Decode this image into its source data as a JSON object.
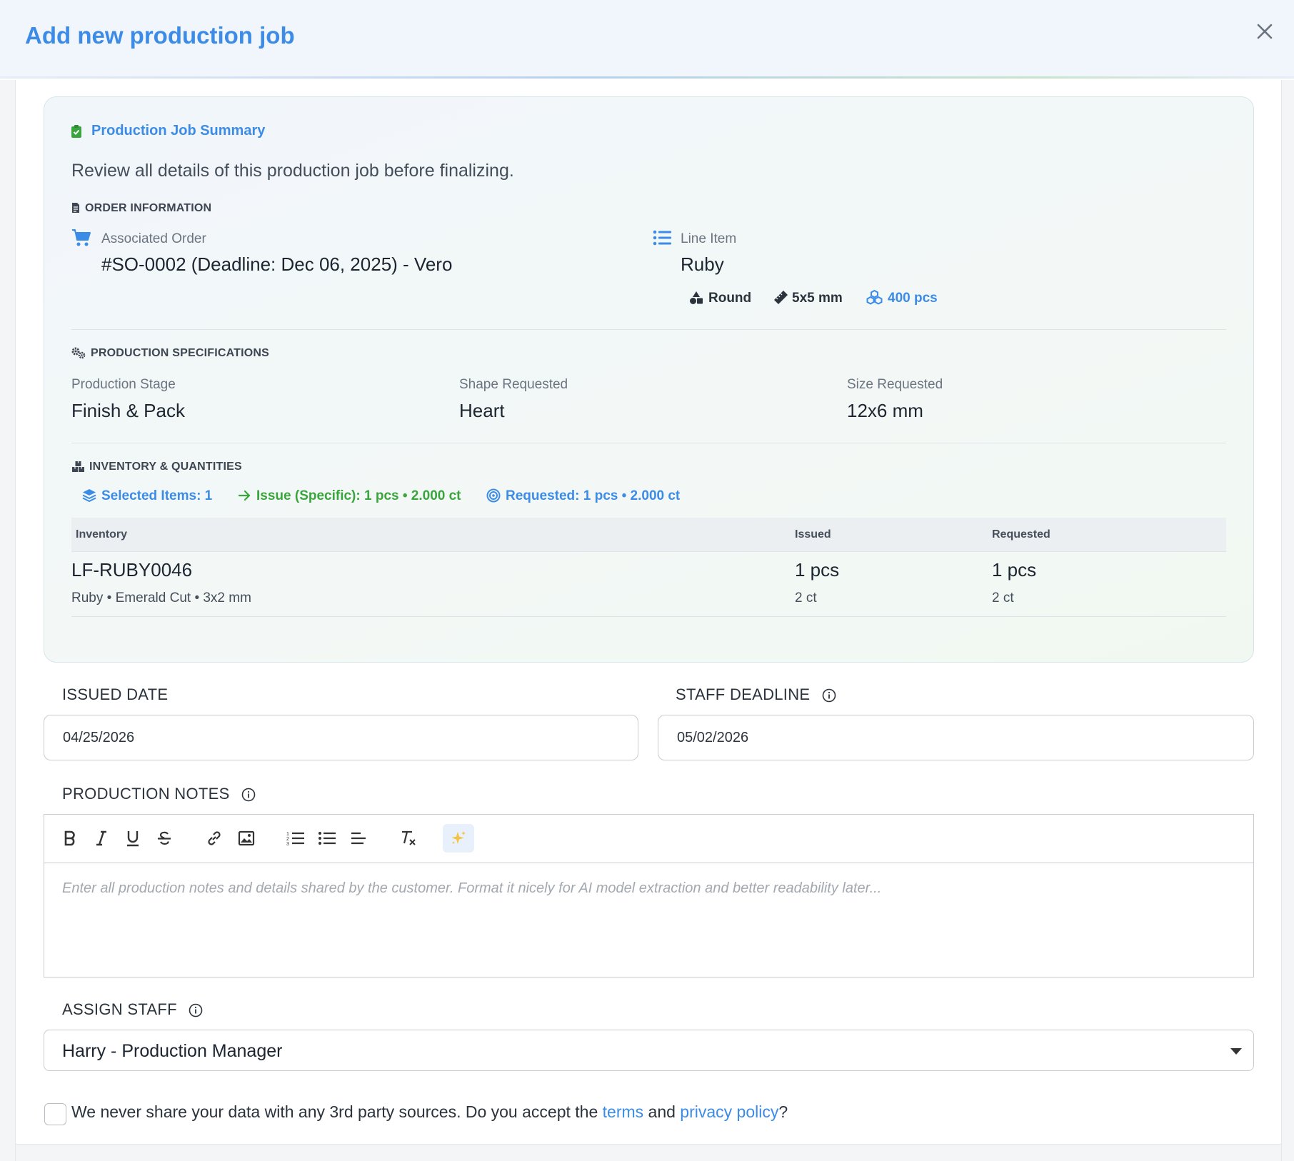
{
  "modal": {
    "title": "Add new production job"
  },
  "summary": {
    "title": "Production Job Summary",
    "description": "Review all details of this production job before finalizing.",
    "order_info": {
      "heading": "ORDER INFORMATION",
      "associated_order_label": "Associated Order",
      "associated_order_value": "#SO-0002 (Deadline: Dec 06, 2025) - Vero",
      "line_item_label": "Line Item",
      "line_item_value": "Ruby",
      "shape": "Round",
      "size": "5x5 mm",
      "quantity": "400 pcs"
    },
    "specs": {
      "heading": "PRODUCTION SPECIFICATIONS",
      "stage_label": "Production Stage",
      "stage_value": "Finish & Pack",
      "shape_label": "Shape Requested",
      "shape_value": "Heart",
      "size_label": "Size Requested",
      "size_value": "12x6 mm"
    },
    "inventory": {
      "heading": "INVENTORY & QUANTITIES",
      "selected_items": "Selected Items: 1",
      "issue_specific": "Issue (Specific): 1 pcs • 2.000 ct",
      "requested": "Requested: 1 pcs • 2.000 ct",
      "columns": [
        "Inventory",
        "Issued",
        "Requested"
      ],
      "rows": [
        {
          "code": "LF-RUBY0046",
          "details": "Ruby • Emerald Cut • 3x2 mm",
          "issued_pcs": "1 pcs",
          "issued_ct": "2 ct",
          "requested_pcs": "1 pcs",
          "requested_ct": "2 ct"
        }
      ]
    }
  },
  "form": {
    "issued_date_label": "ISSUED DATE",
    "issued_date_value": "04/25/2026",
    "staff_deadline_label": "STAFF DEADLINE",
    "staff_deadline_value": "05/02/2026",
    "notes_label": "PRODUCTION NOTES",
    "notes_placeholder": "Enter all production notes and details shared by the customer. Format it nicely for AI model extraction and better readability later...",
    "assign_staff_label": "ASSIGN STAFF",
    "assign_staff_value": "Harry - Production Manager",
    "consent_text_before": "We never share your data with any 3rd party sources. Do you accept the ",
    "consent_terms": "terms",
    "consent_and": " and ",
    "consent_privacy": "privacy policy",
    "consent_end": "?"
  },
  "colors": {
    "accent": "#3c8ce7",
    "success": "#3aa53d"
  }
}
